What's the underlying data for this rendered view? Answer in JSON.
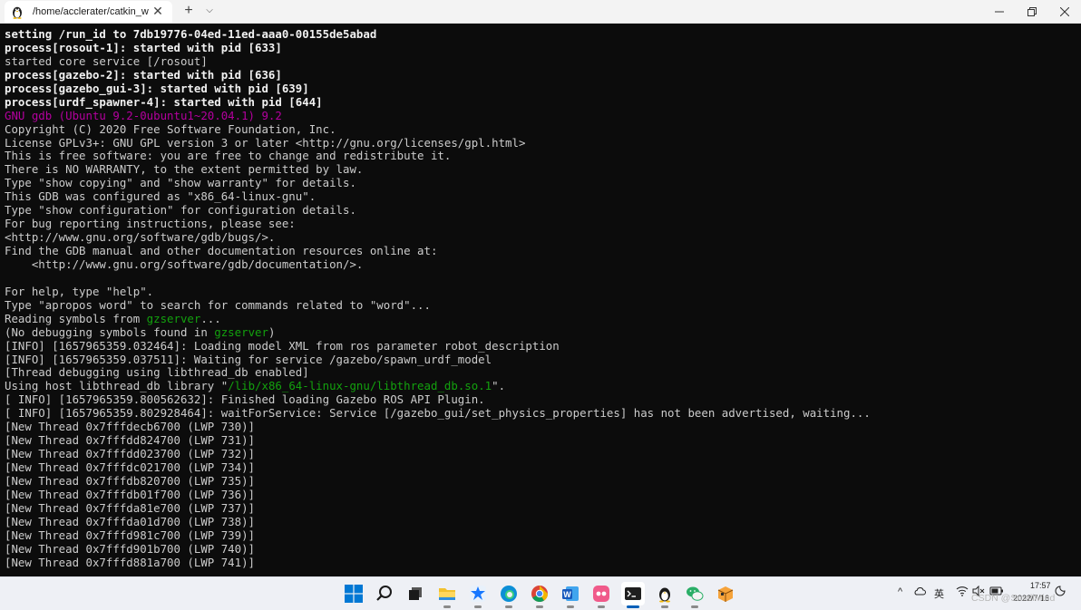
{
  "window": {
    "tab_title": "/home/acclerater/catkin_ws/s",
    "new_tab_symbol": "+",
    "dropdown_symbol": "⌵",
    "close_symbol": "✕"
  },
  "terminal": {
    "lines": [
      {
        "style": "bold",
        "text": "setting /run_id to 7db19776-04ed-11ed-aaa0-00155de5abad"
      },
      {
        "style": "bold",
        "text": "process[rosout-1]: started with pid [633]"
      },
      {
        "style": "normal",
        "text": "started core service [/rosout]"
      },
      {
        "style": "bold",
        "text": "process[gazebo-2]: started with pid [636]"
      },
      {
        "style": "bold",
        "text": "process[gazebo_gui-3]: started with pid [639]"
      },
      {
        "style": "bold",
        "text": "process[urdf_spawner-4]: started with pid [644]"
      },
      {
        "style": "magenta",
        "text": "GNU gdb (Ubuntu 9.2-0ubuntu1~20.04.1) 9.2"
      },
      {
        "style": "normal",
        "text": "Copyright (C) 2020 Free Software Foundation, Inc."
      },
      {
        "style": "normal",
        "text": "License GPLv3+: GNU GPL version 3 or later <http://gnu.org/licenses/gpl.html>"
      },
      {
        "style": "normal",
        "text": "This is free software: you are free to change and redistribute it."
      },
      {
        "style": "normal",
        "text": "There is NO WARRANTY, to the extent permitted by law."
      },
      {
        "style": "normal",
        "text": "Type \"show copying\" and \"show warranty\" for details."
      },
      {
        "style": "normal",
        "text": "This GDB was configured as \"x86_64-linux-gnu\"."
      },
      {
        "style": "normal",
        "text": "Type \"show configuration\" for configuration details."
      },
      {
        "style": "normal",
        "text": "For bug reporting instructions, please see:"
      },
      {
        "style": "normal",
        "text": "<http://www.gnu.org/software/gdb/bugs/>."
      },
      {
        "style": "normal",
        "text": "Find the GDB manual and other documentation resources online at:"
      },
      {
        "style": "normal",
        "text": "    <http://www.gnu.org/software/gdb/documentation/>."
      },
      {
        "style": "normal",
        "text": ""
      },
      {
        "style": "normal",
        "text": "For help, type \"help\"."
      },
      {
        "style": "normal",
        "text": "Type \"apropos word\" to search for commands related to \"word\"..."
      },
      {
        "style": "mixed",
        "parts": [
          {
            "style": "normal",
            "text": "Reading symbols from "
          },
          {
            "style": "green",
            "text": "gzserver"
          },
          {
            "style": "normal",
            "text": "..."
          }
        ]
      },
      {
        "style": "mixed",
        "parts": [
          {
            "style": "normal",
            "text": "(No debugging symbols found in "
          },
          {
            "style": "green",
            "text": "gzserver"
          },
          {
            "style": "normal",
            "text": ")"
          }
        ]
      },
      {
        "style": "normal",
        "text": "[INFO] [1657965359.032464]: Loading model XML from ros parameter robot_description"
      },
      {
        "style": "normal",
        "text": "[INFO] [1657965359.037511]: Waiting for service /gazebo/spawn_urdf_model"
      },
      {
        "style": "normal",
        "text": "[Thread debugging using libthread_db enabled]"
      },
      {
        "style": "mixed",
        "parts": [
          {
            "style": "normal",
            "text": "Using host libthread_db library \""
          },
          {
            "style": "green",
            "text": "/lib/x86_64-linux-gnu/libthread_db.so.1"
          },
          {
            "style": "normal",
            "text": "\"."
          }
        ]
      },
      {
        "style": "normal",
        "text": "[ INFO] [1657965359.800562632]: Finished loading Gazebo ROS API Plugin."
      },
      {
        "style": "normal",
        "text": "[ INFO] [1657965359.802928464]: waitForService: Service [/gazebo_gui/set_physics_properties] has not been advertised, waiting..."
      },
      {
        "style": "normal",
        "text": "[New Thread 0x7fffdecb6700 (LWP 730)]"
      },
      {
        "style": "normal",
        "text": "[New Thread 0x7fffdd824700 (LWP 731)]"
      },
      {
        "style": "normal",
        "text": "[New Thread 0x7fffdd023700 (LWP 732)]"
      },
      {
        "style": "normal",
        "text": "[New Thread 0x7fffdc021700 (LWP 734)]"
      },
      {
        "style": "normal",
        "text": "[New Thread 0x7fffdb820700 (LWP 735)]"
      },
      {
        "style": "normal",
        "text": "[New Thread 0x7fffdb01f700 (LWP 736)]"
      },
      {
        "style": "normal",
        "text": "[New Thread 0x7fffda81e700 (LWP 737)]"
      },
      {
        "style": "normal",
        "text": "[New Thread 0x7fffda01d700 (LWP 738)]"
      },
      {
        "style": "normal",
        "text": "[New Thread 0x7fffd981c700 (LWP 739)]"
      },
      {
        "style": "normal",
        "text": "[New Thread 0x7fffd901b700 (LWP 740)]"
      },
      {
        "style": "normal",
        "text": "[New Thread 0x7fffd881a700 (LWP 741)]"
      }
    ]
  },
  "taskbar": {
    "apps": [
      {
        "name": "start-button",
        "icon": "windows-logo"
      },
      {
        "name": "search-button",
        "icon": "search-icon"
      },
      {
        "name": "task-view-button",
        "icon": "task-view-icon"
      },
      {
        "name": "file-explorer-app",
        "icon": "folder-icon"
      },
      {
        "name": "feishu-app",
        "icon": "bird-icon"
      },
      {
        "name": "edge-app",
        "icon": "edge-icon"
      },
      {
        "name": "chrome-app",
        "icon": "chrome-icon"
      },
      {
        "name": "word-app",
        "icon": "word-icon"
      },
      {
        "name": "pink-app",
        "icon": "pink-app-icon"
      },
      {
        "name": "terminal-app",
        "icon": "terminal-icon"
      },
      {
        "name": "linux-app",
        "icon": "penguin-icon"
      },
      {
        "name": "wechat-app",
        "icon": "wechat-icon"
      },
      {
        "name": "package-app",
        "icon": "box-icon"
      }
    ],
    "tray": {
      "chevron": "^",
      "ime": "英",
      "time": "17:57",
      "date": "2022/7/16"
    }
  },
  "watermark": "CSDN @SmallMind",
  "colors": {
    "terminal_bg": "#0c0c0c",
    "terminal_fg": "#cccccc",
    "bold_fg": "#f2f2f2",
    "magenta": "#b4009e",
    "green": "#13a10e",
    "titlebar_bg": "#f3f3f3",
    "taskbar_bg": "#eef0f5"
  }
}
